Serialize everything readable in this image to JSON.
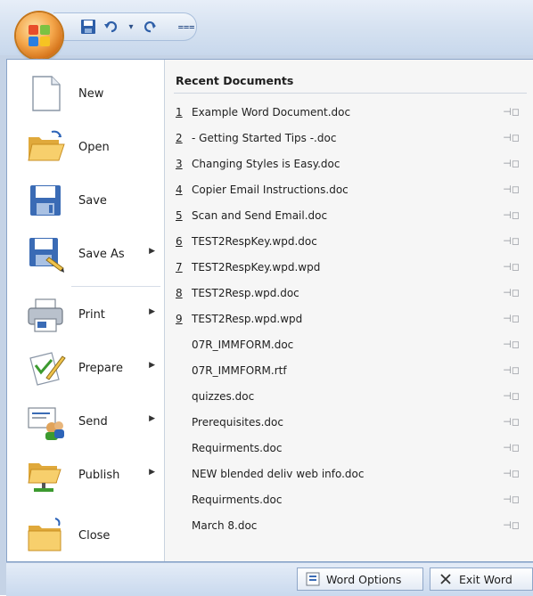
{
  "quick_access": {
    "save_icon": "save-icon",
    "undo_icon": "undo-icon",
    "undo_dropdown": "▾",
    "redo_icon": "redo-icon",
    "customize_glyph": "⩶"
  },
  "menu": {
    "commands": [
      {
        "label": "New",
        "icon": "new-document-icon",
        "submenu": false
      },
      {
        "label": "Open",
        "icon": "open-folder-icon",
        "submenu": false
      },
      {
        "label": "Save",
        "icon": "save-disk-icon",
        "submenu": false
      },
      {
        "label": "Save As",
        "icon": "save-as-icon",
        "submenu": true
      },
      {
        "label": "Print",
        "icon": "printer-icon",
        "submenu": true
      },
      {
        "label": "Prepare",
        "icon": "prepare-icon",
        "submenu": true
      },
      {
        "label": "Send",
        "icon": "send-icon",
        "submenu": true
      },
      {
        "label": "Publish",
        "icon": "publish-icon",
        "submenu": true
      },
      {
        "label": "Close",
        "icon": "close-folder-icon",
        "submenu": false
      }
    ]
  },
  "recent": {
    "header": "Recent Documents",
    "documents": [
      {
        "num": "1",
        "name": "Example Word Document.doc"
      },
      {
        "num": "2",
        "name": "- Getting Started Tips -.doc"
      },
      {
        "num": "3",
        "name": "Changing Styles is Easy.doc"
      },
      {
        "num": "4",
        "name": "Copier Email Instructions.doc"
      },
      {
        "num": "5",
        "name": "Scan and Send Email.doc"
      },
      {
        "num": "6",
        "name": "TEST2RespKey.wpd.doc"
      },
      {
        "num": "7",
        "name": "TEST2RespKey.wpd.wpd"
      },
      {
        "num": "8",
        "name": "TEST2Resp.wpd.doc"
      },
      {
        "num": "9",
        "name": "TEST2Resp.wpd.wpd"
      },
      {
        "num": "",
        "name": "07R_IMMFORM.doc"
      },
      {
        "num": "",
        "name": "07R_IMMFORM.rtf"
      },
      {
        "num": "",
        "name": "quizzes.doc"
      },
      {
        "num": "",
        "name": "Prerequisites.doc"
      },
      {
        "num": "",
        "name": "Requirments.doc"
      },
      {
        "num": "",
        "name": "NEW blended deliv web info.doc"
      },
      {
        "num": "",
        "name": "Requirments.doc"
      },
      {
        "num": "",
        "name": "March 8.doc"
      }
    ],
    "pin_icon": "pin-icon"
  },
  "footer": {
    "options_label": "Word Options",
    "exit_label": "Exit Word"
  },
  "colors": {
    "accent": "#f4a64a",
    "frame": "#c5d3e6",
    "panel_right": "#f6f6f6"
  }
}
